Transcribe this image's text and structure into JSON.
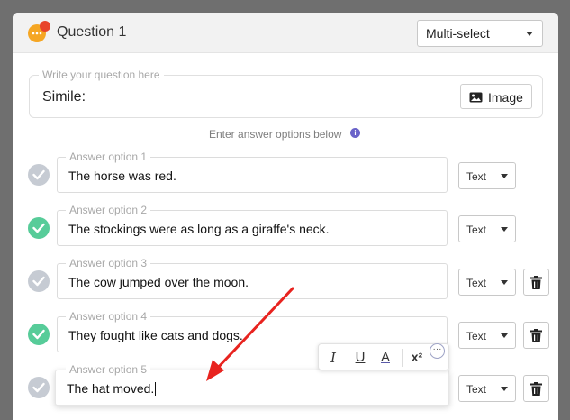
{
  "question": {
    "title": "Question 1",
    "type_value": "Multi-select",
    "prompt_label": "Write your question here",
    "prompt_text": "Simile:",
    "image_button": "Image"
  },
  "hint": "Enter answer options below",
  "answers": [
    {
      "label": "Answer option 1",
      "text": "The horse was red.",
      "correct": false,
      "type": "Text",
      "has_delete": false
    },
    {
      "label": "Answer option 2",
      "text": "The stockings were as long as a giraffe's neck.",
      "correct": true,
      "type": "Text",
      "has_delete": false
    },
    {
      "label": "Answer option 3",
      "text": "The cow jumped over the moon.",
      "correct": false,
      "type": "Text",
      "has_delete": true
    },
    {
      "label": "Answer option 4",
      "text": "They fought like cats and dogs.",
      "correct": true,
      "type": "Text",
      "has_delete": true
    },
    {
      "label": "Answer option 5",
      "text": "The hat moved.",
      "correct": false,
      "type": "Text",
      "has_delete": true
    }
  ],
  "toolbar": {
    "italic": "I",
    "underline": "U",
    "color": "A",
    "superscript": "x²",
    "more": "···"
  },
  "colors": {
    "correct_green": "#57cc99",
    "unchecked_gray": "#c6cbd3",
    "annotation_arrow": "#e8231f",
    "info_purple": "#6a63c9"
  }
}
